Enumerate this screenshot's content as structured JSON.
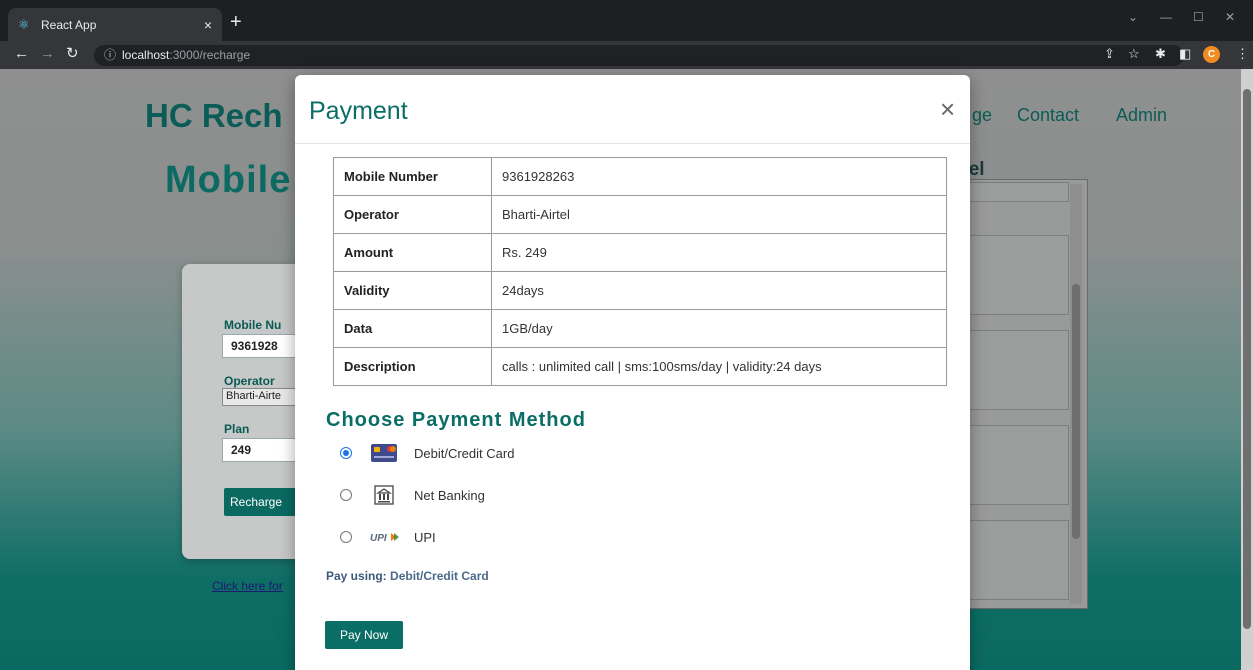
{
  "browser": {
    "tab_title": "React App",
    "tab_close": "×",
    "new_tab": "+",
    "url_host": "localhost",
    "url_path": ":3000/recharge",
    "profile_initial": "C"
  },
  "page": {
    "brand": "HC Rech",
    "nav": {
      "item_partial": "ge",
      "contact": "Contact",
      "admin": "Admin"
    },
    "heading": "Mobile",
    "operator_partial": "rtel",
    "form": {
      "mobile_label": "Mobile Nu",
      "mobile_value": "9361928",
      "operator_label": "Operator",
      "operator_value": "Bharti-Airte",
      "plan_label": "Plan",
      "plan_value": "249",
      "recharge_button": "Recharge"
    },
    "click_link": "Click here for"
  },
  "modal": {
    "title": "Payment",
    "close": "×",
    "details": [
      {
        "key": "Mobile Number",
        "value": "9361928263"
      },
      {
        "key": "Operator",
        "value": "Bharti-Airtel"
      },
      {
        "key": "Amount",
        "value": "Rs. 249"
      },
      {
        "key": "Validity",
        "value": "24days"
      },
      {
        "key": "Data",
        "value": "1GB/day"
      },
      {
        "key": "Description",
        "value": "calls : unlimited call | sms:100sms/day | validity:24 days"
      }
    ],
    "payment_heading": "Choose Payment Method",
    "methods": [
      {
        "label": "Debit/Credit Card",
        "icon": "credit-card-icon",
        "selected": true
      },
      {
        "label": "Net Banking",
        "icon": "bank-icon",
        "selected": false
      },
      {
        "label": "UPI",
        "icon": "upi-icon",
        "selected": false
      }
    ],
    "pay_using_label": "Pay using:",
    "pay_using_value": "Debit/Credit Card",
    "pay_button": "Pay Now",
    "accent_color": "#0b6e66"
  }
}
